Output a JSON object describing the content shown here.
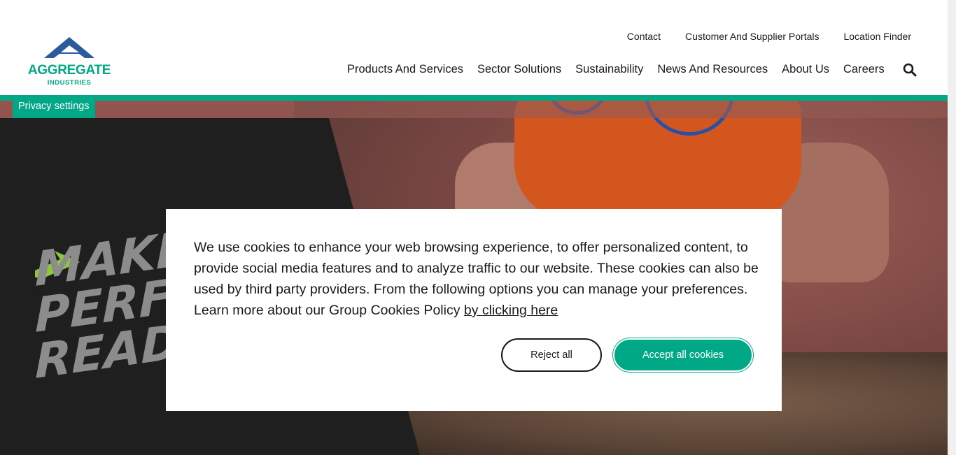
{
  "header": {
    "logo": {
      "name": "AGGREGATE",
      "sub": "INDUSTRIES"
    },
    "utility_nav": [
      "Contact",
      "Customer And Supplier Portals",
      "Location Finder"
    ],
    "main_nav": [
      "Products And Services",
      "Sector Solutions",
      "Sustainability",
      "News And Resources",
      "About Us",
      "Careers"
    ],
    "search_icon": "search-icon"
  },
  "privacy_settings": "Privacy settings",
  "hero": {
    "tagline": [
      "MAKE",
      "PERFO",
      "READY"
    ]
  },
  "cookie": {
    "text": "We use cookies to enhance your web browsing experience, to offer personalized content, to provide social media features and to analyze traffic to our website. These cookies can also be used by third party providers. From the following options you can manage your preferences. Learn more about our Group Cookies Policy ",
    "link": "by clicking here",
    "reject_label": "Reject all",
    "accept_label": "Accept all cookies"
  },
  "colors": {
    "brand_green": "#00a886",
    "brand_blue": "#2b5b9a",
    "accent_lime": "#8dc63f"
  }
}
